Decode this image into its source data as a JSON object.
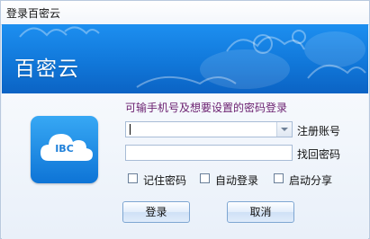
{
  "window": {
    "title": "登录百密云"
  },
  "banner": {
    "title": "百密云"
  },
  "logo": {
    "text": "IBC"
  },
  "form": {
    "hint": "可输手机号及想要设置的密码登录",
    "account": {
      "value": "",
      "placeholder": ""
    },
    "password": {
      "value": "",
      "placeholder": ""
    },
    "register_label": "注册账号",
    "recover_label": "找回密码"
  },
  "options": {
    "remember_password": {
      "label": "记住密码",
      "checked": false
    },
    "auto_login": {
      "label": "自动登录",
      "checked": false
    },
    "auto_share": {
      "label": "启动分享",
      "checked": false
    }
  },
  "buttons": {
    "login": "登录",
    "cancel": "取消"
  },
  "colors": {
    "banner": "#1178da",
    "hint_text": "#6a1f6f",
    "logo": "#2a93e8"
  }
}
